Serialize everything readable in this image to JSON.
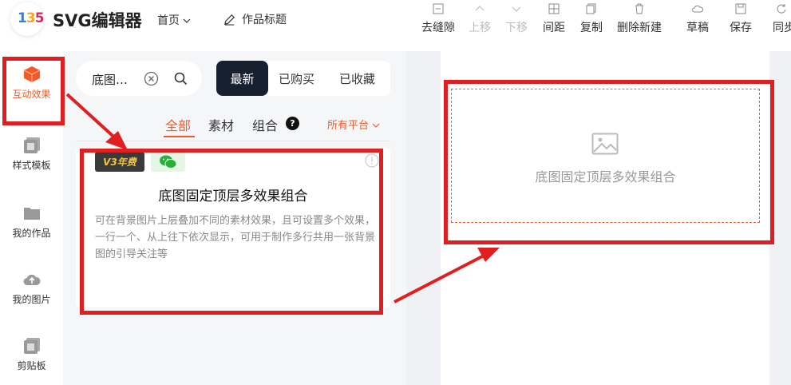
{
  "header": {
    "logo_text": "135",
    "brand": "SVG编辑器",
    "nav_home": "首页",
    "title_edit": "作品标题"
  },
  "toolbar": [
    {
      "id": "remove-gap",
      "label": "去缝隙",
      "icon": "gap-icon",
      "disabled": false
    },
    {
      "id": "move-up",
      "label": "上移",
      "icon": "chevron-up-icon",
      "disabled": true
    },
    {
      "id": "move-down",
      "label": "下移",
      "icon": "chevron-down-icon",
      "disabled": true
    },
    {
      "id": "spacing",
      "label": "间距",
      "icon": "spacing-icon",
      "disabled": false
    },
    {
      "id": "copy",
      "label": "复制",
      "icon": "copy-icon",
      "disabled": false
    },
    {
      "id": "delete-new",
      "label": "删除新建",
      "icon": "delete-icon",
      "disabled": false
    },
    {
      "id": "draft",
      "label": "草稿",
      "icon": "cloud-icon",
      "disabled": false
    },
    {
      "id": "save",
      "label": "保存",
      "icon": "save-icon",
      "disabled": false
    },
    {
      "id": "sync",
      "label": "同步",
      "icon": "sync-icon",
      "disabled": false
    }
  ],
  "sidebar": {
    "items": [
      {
        "label": "互动效果",
        "icon": "cube-icon",
        "active": true
      },
      {
        "label": "样式模板",
        "icon": "template-icon",
        "active": false
      },
      {
        "label": "我的作品",
        "icon": "folder-icon",
        "active": false
      },
      {
        "label": "我的图片",
        "icon": "cloud-upload-icon",
        "active": false
      },
      {
        "label": "剪贴板",
        "icon": "clipboard-icon",
        "active": false
      }
    ]
  },
  "search": {
    "value": "底图…"
  },
  "segment_tabs": [
    {
      "label": "最新",
      "active": true
    },
    {
      "label": "已购买",
      "active": false
    },
    {
      "label": "已收藏",
      "active": false
    }
  ],
  "sub_tabs": [
    {
      "label": "全部",
      "active": true
    },
    {
      "label": "素材",
      "active": false
    },
    {
      "label": "组合",
      "active": false
    }
  ],
  "help_badge": "?",
  "platform_filter": "所有平台",
  "card": {
    "tag_v3": "V3年费",
    "title": "底图固定顶层多效果组合",
    "description": "可在背景图片上层叠加不同的素材效果，且可设置多个效果，一行一个、从上往下依次显示，可用于制作多行共用一张背景图的引导关注等"
  },
  "canvas": {
    "placeholder_text": "底图固定顶层多效果组合"
  },
  "colors": {
    "accent": "#f25a29",
    "annotation_red": "#e02020",
    "segment_dark": "#17202e"
  }
}
